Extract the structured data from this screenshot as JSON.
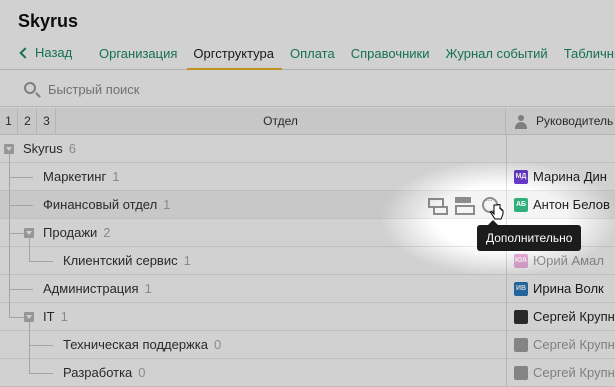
{
  "app": {
    "title": "Skyrus"
  },
  "nav": {
    "back_label": "Назад",
    "tabs": [
      "Организация",
      "Оргструктура",
      "Оплата",
      "Справочники",
      "Журнал событий",
      "Табличный"
    ],
    "active_tab": "Оргструктура"
  },
  "search": {
    "placeholder": "Быстрый поиск",
    "value": ""
  },
  "grid": {
    "levels": [
      "1",
      "2",
      "3"
    ],
    "dept_header": "Отдел",
    "manager_header": "Руководитель",
    "rows": [
      {
        "name": "Skyrus",
        "count": "6",
        "manager": "",
        "initials": "",
        "color": ""
      },
      {
        "name": "Маркетинг",
        "count": "1",
        "manager": "Марина Дин",
        "initials": "МД",
        "color": "#6a3bd1"
      },
      {
        "name": "Финансовый отдел",
        "count": "1",
        "manager": "Антон Белов",
        "initials": "АБ",
        "color": "#2fb07a"
      },
      {
        "name": "Продажи",
        "count": "2",
        "manager": "",
        "initials": "",
        "color": ""
      },
      {
        "name": "Клиентский сервис",
        "count": "1",
        "manager": "Юрий Амал",
        "initials": "ЮА",
        "color": "#d24bb6"
      },
      {
        "name": "Администрация",
        "count": "1",
        "manager": "Ирина Волк",
        "initials": "ИВ",
        "color": "#2a7bbf"
      },
      {
        "name": "IT",
        "count": "1",
        "manager": "Сергей Крупн",
        "initials": "",
        "color": "#333333"
      },
      {
        "name": "Техническая поддержка",
        "count": "0",
        "manager": "Сергей Крупн",
        "initials": "",
        "color": "#333333"
      },
      {
        "name": "Разработка",
        "count": "0",
        "manager": "Сергей Крупн",
        "initials": "",
        "color": "#333333"
      }
    ]
  },
  "tooltip": {
    "text": "Дополнительно"
  },
  "colors": {
    "accent": "#1a8a6a",
    "active_underline": "#e8b228"
  }
}
